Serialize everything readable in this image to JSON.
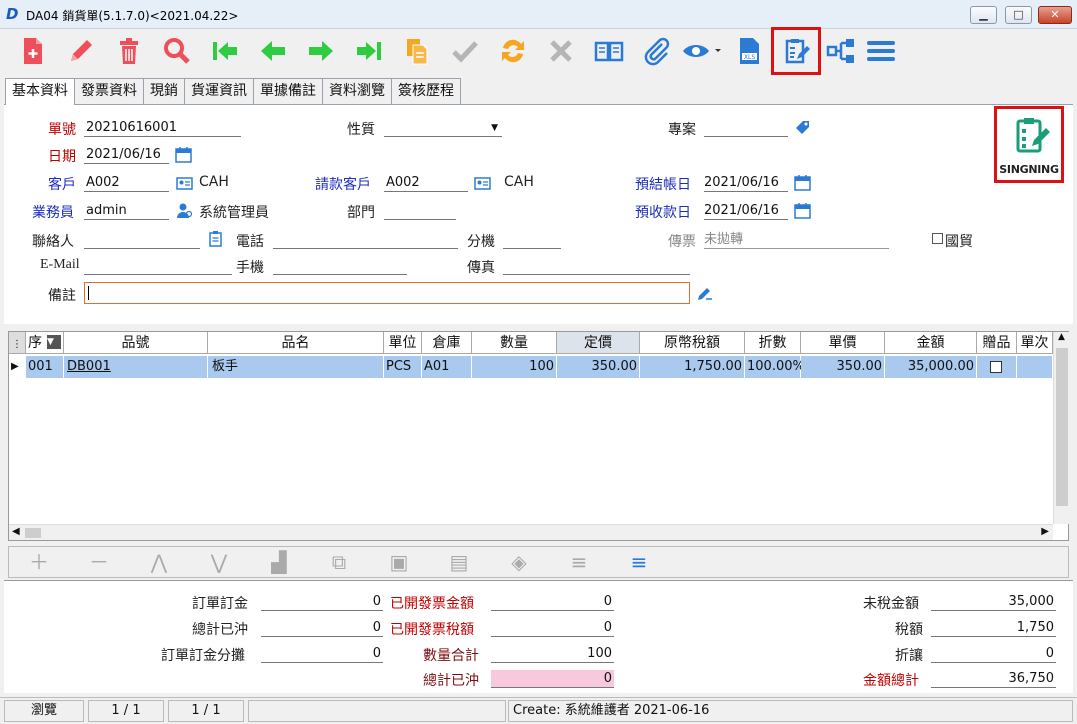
{
  "window": {
    "title": "DA04 銷貨單(5.1.7.0)<2021.04.22>",
    "app_icon": "D"
  },
  "tabs": [
    "基本資料",
    "發票資料",
    "現銷",
    "貨運資訊",
    "單據備註",
    "資料瀏覽",
    "簽核歷程"
  ],
  "signing_label": "SINGNING",
  "form": {
    "order_no": {
      "label": "單號",
      "value": "20210616001"
    },
    "nature": {
      "label": "性質"
    },
    "project": {
      "label": "專案"
    },
    "date": {
      "label": "日期",
      "value": "2021/06/16"
    },
    "customer": {
      "label": "客戶",
      "value": "A002",
      "name": "CAH"
    },
    "bill_customer": {
      "label": "請款客戶",
      "value": "A002",
      "name": "CAH"
    },
    "expected_close": {
      "label": "預結帳日",
      "value": "2021/06/16"
    },
    "salesperson": {
      "label": "業務員",
      "value": "admin",
      "name": "系統管理員"
    },
    "department": {
      "label": "部門"
    },
    "expected_receipt": {
      "label": "預收款日",
      "value": "2021/06/16"
    },
    "contact": {
      "label": "聯絡人"
    },
    "phone": {
      "label": "電話"
    },
    "ext": {
      "label": "分機"
    },
    "fax_forward": {
      "label": "傳票",
      "value": "未拋轉"
    },
    "intl_trade": {
      "label": "國貿"
    },
    "email": {
      "label": "E-Mail"
    },
    "mobile": {
      "label": "手機"
    },
    "fax": {
      "label": "傳真"
    },
    "remark": {
      "label": "備註"
    }
  },
  "grid": {
    "headers": [
      "序",
      "品號",
      "品名",
      "單位",
      "倉庫",
      "數量",
      "定價",
      "原幣稅額",
      "折數",
      "單價",
      "金額",
      "贈品",
      "單次"
    ],
    "rows": [
      {
        "seq": "001",
        "item_no": "DB001",
        "item_name": "板手",
        "unit": "PCS",
        "warehouse": "A01",
        "qty": "100",
        "list_price": "350.00",
        "tax": "1,750.00",
        "discount": "100.00%",
        "unit_price": "350.00",
        "amount": "35,000.00"
      }
    ]
  },
  "summary": {
    "order_deposit": {
      "label": "訂單訂金",
      "value": "0"
    },
    "total_offset": {
      "label": "總計已沖",
      "value": "0"
    },
    "deposit_alloc": {
      "label": "訂單訂金分攤",
      "value": "0"
    },
    "invoiced_amount": {
      "label": "已開發票金額",
      "value": "0"
    },
    "invoiced_tax": {
      "label": "已開發票稅額",
      "value": "0"
    },
    "qty_total": {
      "label": "數量合計",
      "value": "100"
    },
    "total_offset2": {
      "label": "總計已沖",
      "value": "0"
    },
    "untaxed": {
      "label": "未稅金額",
      "value": "35,000"
    },
    "tax": {
      "label": "稅額",
      "value": "1,750"
    },
    "discount": {
      "label": "折讓",
      "value": "0"
    },
    "grand_total": {
      "label": "金額總計",
      "value": "36,750"
    }
  },
  "status": {
    "mode": "瀏覽",
    "page1": "1 / 1",
    "page2": "1 / 1",
    "create": "Create: 系統維護者 2021-06-16"
  }
}
